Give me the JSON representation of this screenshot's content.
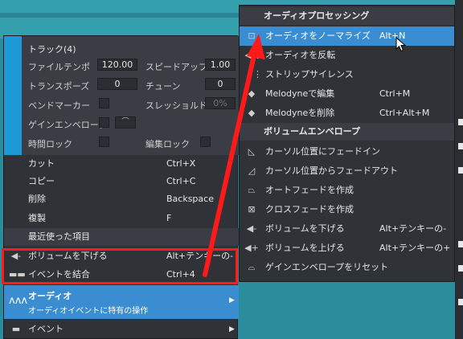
{
  "track_panel": {
    "title": "トラック(4)",
    "file_tempo_label": "ファイルテンポ",
    "file_tempo_value": "120.00",
    "speedup_label": "スピードアップ",
    "speedup_value": "1.00",
    "transpose_label": "トランスポーズ",
    "transpose_value": "0",
    "tune_label": "チューン",
    "tune_value": "0",
    "bend_marker_label": "ベンドマーカー",
    "threshold_label": "スレッショルド",
    "threshold_value": "0%",
    "gain_envelope_label": "ゲインエンベロープ",
    "time_lock_label": "時間ロック",
    "edit_lock_label": "編集ロック"
  },
  "context_menu": {
    "items": [
      {
        "label": "カット",
        "shortcut": "Ctrl+X"
      },
      {
        "label": "コピー",
        "shortcut": "Ctrl+C"
      },
      {
        "label": "削除",
        "shortcut": "Backspace"
      },
      {
        "label": "複製",
        "shortcut": "F"
      }
    ],
    "recent_section": "最近使った項目",
    "recent_items": [
      {
        "label": "ボリュームを下げる",
        "shortcut": "Alt+テンキーの-"
      },
      {
        "label": "イベントを結合",
        "shortcut": "Ctrl+4"
      }
    ],
    "audio_item": {
      "label": "オーディオ",
      "description": "オーディオイベントに特有の操作"
    },
    "event_item": {
      "label": "イベント"
    }
  },
  "submenu": {
    "section1": "オーディオプロセッシング",
    "items1": [
      {
        "label": "オーディオをノーマライズ",
        "shortcut": "Alt+N"
      },
      {
        "label": "オーディオを反転",
        "shortcut": ""
      },
      {
        "label": "ストリップサイレンス",
        "shortcut": ""
      },
      {
        "label": "Melodyneで編集",
        "shortcut": "Ctrl+M"
      },
      {
        "label": "Melodyneを削除",
        "shortcut": "Ctrl+Alt+M"
      }
    ],
    "section2": "ボリュームエンベロープ",
    "items2": [
      {
        "label": "カーソル位置にフェードイン",
        "shortcut": ""
      },
      {
        "label": "カーソル位置からフェードアウト",
        "shortcut": ""
      },
      {
        "label": "オートフェードを作成",
        "shortcut": ""
      },
      {
        "label": "クロスフェードを作成",
        "shortcut": ""
      },
      {
        "label": "ボリュームを下げる",
        "shortcut": "Alt+テンキーの-"
      },
      {
        "label": "ボリュームを上げる",
        "shortcut": "Alt+テンキーの+"
      },
      {
        "label": "ゲインエンベロープをリセット",
        "shortcut": ""
      }
    ]
  },
  "colors": {
    "accent": "#3a8dd1",
    "menu_bg": "#2f3338",
    "annotation_red": "#ff1a1a",
    "track_color": "#1d9ad6"
  }
}
